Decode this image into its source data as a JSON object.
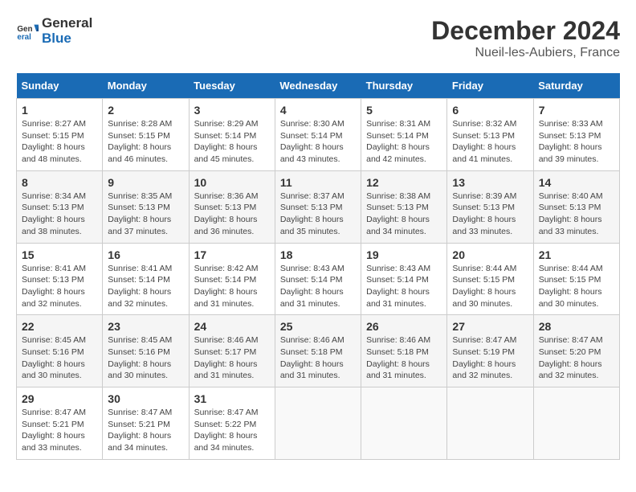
{
  "logo": {
    "line1": "General",
    "line2": "Blue"
  },
  "title": "December 2024",
  "subtitle": "Nueil-les-Aubiers, France",
  "headers": [
    "Sunday",
    "Monday",
    "Tuesday",
    "Wednesday",
    "Thursday",
    "Friday",
    "Saturday"
  ],
  "weeks": [
    [
      {
        "day": "1",
        "sunrise": "Sunrise: 8:27 AM",
        "sunset": "Sunset: 5:15 PM",
        "daylight": "Daylight: 8 hours and 48 minutes."
      },
      {
        "day": "2",
        "sunrise": "Sunrise: 8:28 AM",
        "sunset": "Sunset: 5:15 PM",
        "daylight": "Daylight: 8 hours and 46 minutes."
      },
      {
        "day": "3",
        "sunrise": "Sunrise: 8:29 AM",
        "sunset": "Sunset: 5:14 PM",
        "daylight": "Daylight: 8 hours and 45 minutes."
      },
      {
        "day": "4",
        "sunrise": "Sunrise: 8:30 AM",
        "sunset": "Sunset: 5:14 PM",
        "daylight": "Daylight: 8 hours and 43 minutes."
      },
      {
        "day": "5",
        "sunrise": "Sunrise: 8:31 AM",
        "sunset": "Sunset: 5:14 PM",
        "daylight": "Daylight: 8 hours and 42 minutes."
      },
      {
        "day": "6",
        "sunrise": "Sunrise: 8:32 AM",
        "sunset": "Sunset: 5:13 PM",
        "daylight": "Daylight: 8 hours and 41 minutes."
      },
      {
        "day": "7",
        "sunrise": "Sunrise: 8:33 AM",
        "sunset": "Sunset: 5:13 PM",
        "daylight": "Daylight: 8 hours and 39 minutes."
      }
    ],
    [
      {
        "day": "8",
        "sunrise": "Sunrise: 8:34 AM",
        "sunset": "Sunset: 5:13 PM",
        "daylight": "Daylight: 8 hours and 38 minutes."
      },
      {
        "day": "9",
        "sunrise": "Sunrise: 8:35 AM",
        "sunset": "Sunset: 5:13 PM",
        "daylight": "Daylight: 8 hours and 37 minutes."
      },
      {
        "day": "10",
        "sunrise": "Sunrise: 8:36 AM",
        "sunset": "Sunset: 5:13 PM",
        "daylight": "Daylight: 8 hours and 36 minutes."
      },
      {
        "day": "11",
        "sunrise": "Sunrise: 8:37 AM",
        "sunset": "Sunset: 5:13 PM",
        "daylight": "Daylight: 8 hours and 35 minutes."
      },
      {
        "day": "12",
        "sunrise": "Sunrise: 8:38 AM",
        "sunset": "Sunset: 5:13 PM",
        "daylight": "Daylight: 8 hours and 34 minutes."
      },
      {
        "day": "13",
        "sunrise": "Sunrise: 8:39 AM",
        "sunset": "Sunset: 5:13 PM",
        "daylight": "Daylight: 8 hours and 33 minutes."
      },
      {
        "day": "14",
        "sunrise": "Sunrise: 8:40 AM",
        "sunset": "Sunset: 5:13 PM",
        "daylight": "Daylight: 8 hours and 33 minutes."
      }
    ],
    [
      {
        "day": "15",
        "sunrise": "Sunrise: 8:41 AM",
        "sunset": "Sunset: 5:13 PM",
        "daylight": "Daylight: 8 hours and 32 minutes."
      },
      {
        "day": "16",
        "sunrise": "Sunrise: 8:41 AM",
        "sunset": "Sunset: 5:14 PM",
        "daylight": "Daylight: 8 hours and 32 minutes."
      },
      {
        "day": "17",
        "sunrise": "Sunrise: 8:42 AM",
        "sunset": "Sunset: 5:14 PM",
        "daylight": "Daylight: 8 hours and 31 minutes."
      },
      {
        "day": "18",
        "sunrise": "Sunrise: 8:43 AM",
        "sunset": "Sunset: 5:14 PM",
        "daylight": "Daylight: 8 hours and 31 minutes."
      },
      {
        "day": "19",
        "sunrise": "Sunrise: 8:43 AM",
        "sunset": "Sunset: 5:14 PM",
        "daylight": "Daylight: 8 hours and 31 minutes."
      },
      {
        "day": "20",
        "sunrise": "Sunrise: 8:44 AM",
        "sunset": "Sunset: 5:15 PM",
        "daylight": "Daylight: 8 hours and 30 minutes."
      },
      {
        "day": "21",
        "sunrise": "Sunrise: 8:44 AM",
        "sunset": "Sunset: 5:15 PM",
        "daylight": "Daylight: 8 hours and 30 minutes."
      }
    ],
    [
      {
        "day": "22",
        "sunrise": "Sunrise: 8:45 AM",
        "sunset": "Sunset: 5:16 PM",
        "daylight": "Daylight: 8 hours and 30 minutes."
      },
      {
        "day": "23",
        "sunrise": "Sunrise: 8:45 AM",
        "sunset": "Sunset: 5:16 PM",
        "daylight": "Daylight: 8 hours and 30 minutes."
      },
      {
        "day": "24",
        "sunrise": "Sunrise: 8:46 AM",
        "sunset": "Sunset: 5:17 PM",
        "daylight": "Daylight: 8 hours and 31 minutes."
      },
      {
        "day": "25",
        "sunrise": "Sunrise: 8:46 AM",
        "sunset": "Sunset: 5:18 PM",
        "daylight": "Daylight: 8 hours and 31 minutes."
      },
      {
        "day": "26",
        "sunrise": "Sunrise: 8:46 AM",
        "sunset": "Sunset: 5:18 PM",
        "daylight": "Daylight: 8 hours and 31 minutes."
      },
      {
        "day": "27",
        "sunrise": "Sunrise: 8:47 AM",
        "sunset": "Sunset: 5:19 PM",
        "daylight": "Daylight: 8 hours and 32 minutes."
      },
      {
        "day": "28",
        "sunrise": "Sunrise: 8:47 AM",
        "sunset": "Sunset: 5:20 PM",
        "daylight": "Daylight: 8 hours and 32 minutes."
      }
    ],
    [
      {
        "day": "29",
        "sunrise": "Sunrise: 8:47 AM",
        "sunset": "Sunset: 5:21 PM",
        "daylight": "Daylight: 8 hours and 33 minutes."
      },
      {
        "day": "30",
        "sunrise": "Sunrise: 8:47 AM",
        "sunset": "Sunset: 5:21 PM",
        "daylight": "Daylight: 8 hours and 34 minutes."
      },
      {
        "day": "31",
        "sunrise": "Sunrise: 8:47 AM",
        "sunset": "Sunset: 5:22 PM",
        "daylight": "Daylight: 8 hours and 34 minutes."
      },
      null,
      null,
      null,
      null
    ]
  ]
}
